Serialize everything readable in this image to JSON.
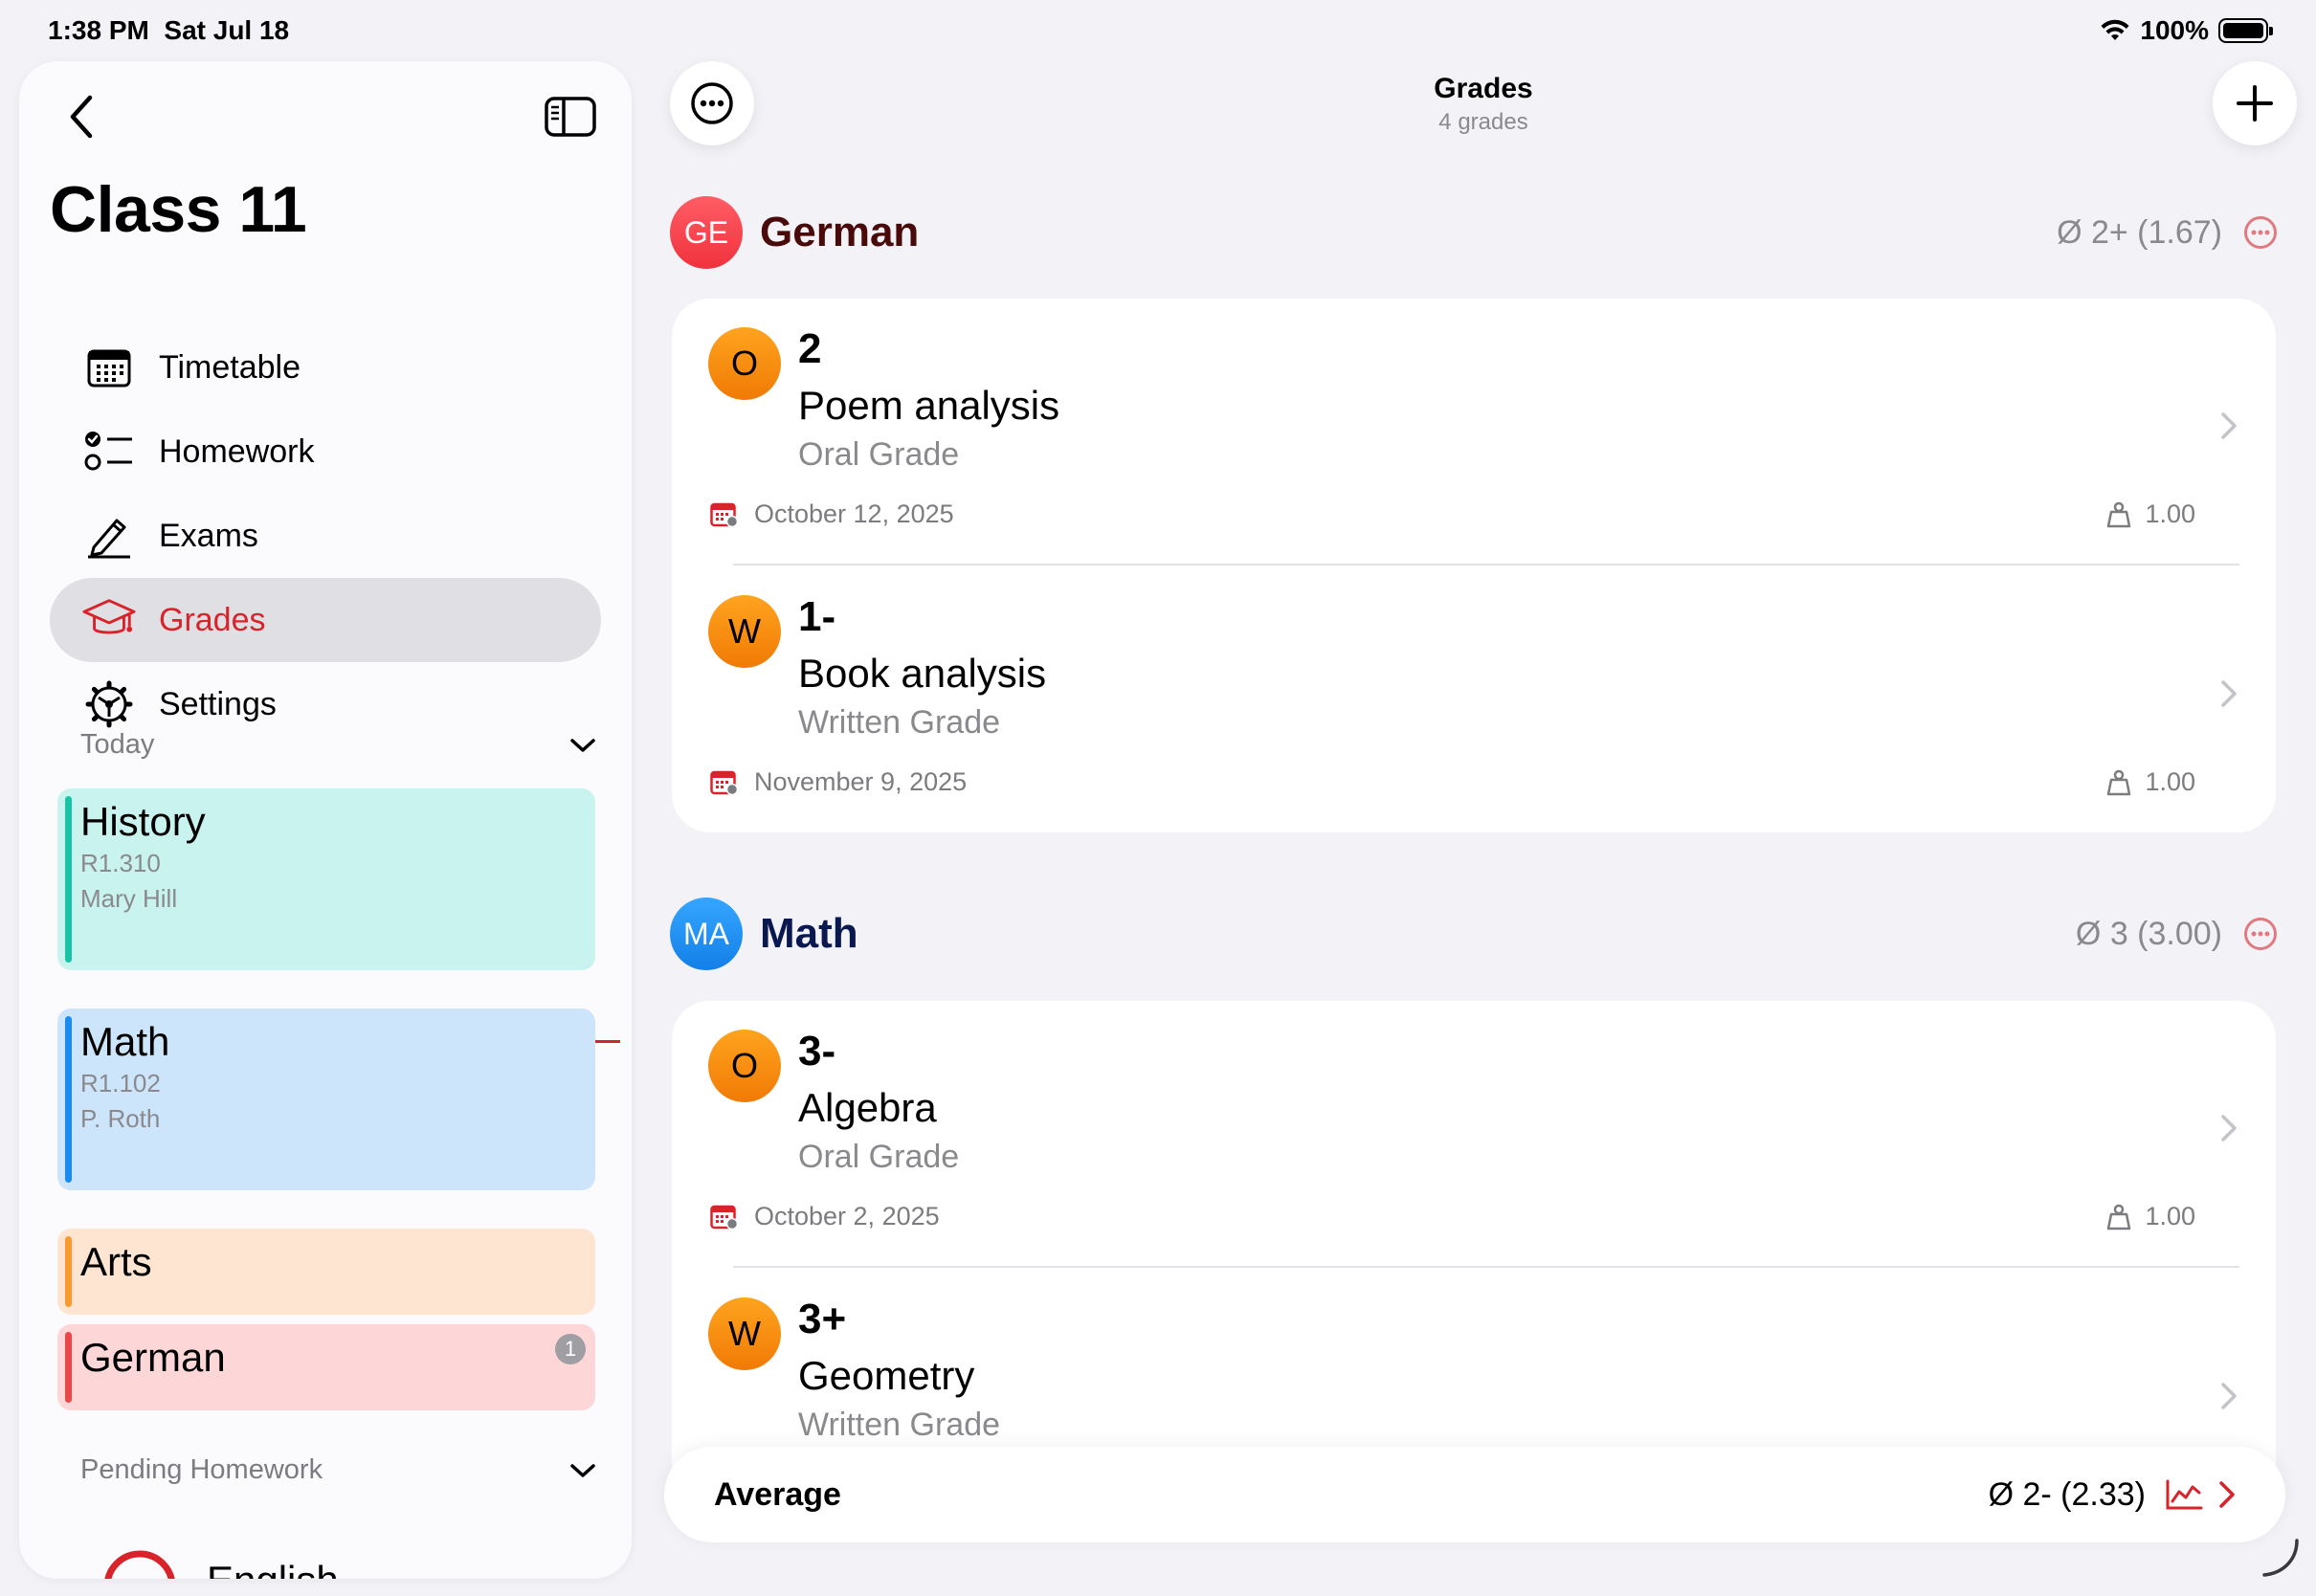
{
  "status": {
    "time": "1:38 PM",
    "date": "Sat Jul 18",
    "battery": "100%"
  },
  "sidebar": {
    "title": "Class 11",
    "nav": [
      {
        "label": "Timetable",
        "icon": "calendar-icon",
        "active": false
      },
      {
        "label": "Homework",
        "icon": "checklist-icon",
        "active": false
      },
      {
        "label": "Exams",
        "icon": "pencil-icon",
        "active": false
      },
      {
        "label": "Grades",
        "icon": "graduation-cap-icon",
        "active": true
      },
      {
        "label": "Settings",
        "icon": "gear-icon",
        "active": false
      }
    ],
    "today_label": "Today",
    "lessons": [
      {
        "title": "History",
        "room": "R1.310",
        "teacher": "Mary Hill",
        "color": "#c9f3ee",
        "accent": "#18c3a8"
      },
      {
        "title": "Math",
        "room": "R1.102",
        "teacher": "P. Roth",
        "color": "#cce5fb",
        "accent": "#1a8cf0"
      },
      {
        "title": "Arts",
        "color": "#fde5d2",
        "accent": "#f79a30"
      },
      {
        "title": "German",
        "color": "#fdd7d7",
        "accent": "#ea4848",
        "badge": "1"
      }
    ],
    "pending_label": "Pending Homework",
    "pending_first": "English"
  },
  "header": {
    "title": "Grades",
    "subtitle": "4 grades"
  },
  "subjects": [
    {
      "abbr": "GE",
      "name": "German",
      "average": "Ø 2+ (1.67)",
      "avatar_color": "#ff4d57",
      "name_color": "#4a0a0a",
      "grades": [
        {
          "type_letter": "O",
          "value": "2",
          "name": "Poem analysis",
          "type": "Oral Grade",
          "date": "October 12, 2025",
          "weight": "1.00"
        },
        {
          "type_letter": "W",
          "value": "1-",
          "name": "Book analysis",
          "type": "Written Grade",
          "date": "November 9, 2025",
          "weight": "1.00"
        }
      ]
    },
    {
      "abbr": "MA",
      "name": "Math",
      "average": "Ø 3 (3.00)",
      "avatar_color": "#1f8ff2",
      "name_color": "#0a1850",
      "grades": [
        {
          "type_letter": "O",
          "value": "3-",
          "name": "Algebra",
          "type": "Oral Grade",
          "date": "October 2, 2025",
          "weight": "1.00"
        },
        {
          "type_letter": "W",
          "value": "3+",
          "name": "Geometry",
          "type": "Written Grade"
        }
      ]
    }
  ],
  "average_bar": {
    "label": "Average",
    "value": "Ø 2- (2.33)"
  },
  "colors": {
    "accent": "#d8232a",
    "orange": "#f58a10"
  }
}
